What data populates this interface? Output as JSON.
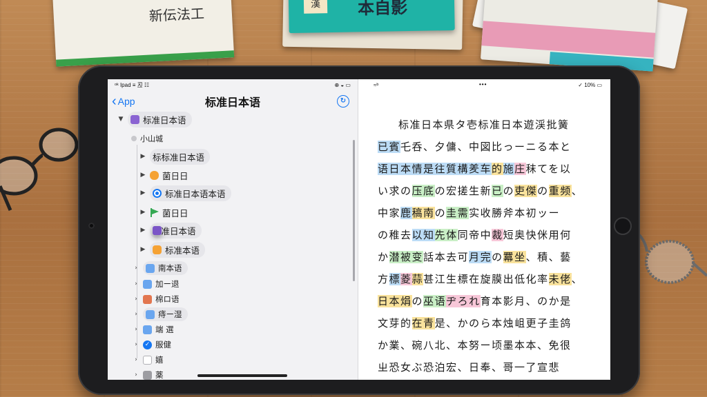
{
  "books": {
    "book1_title": "新伝法工",
    "book2_tag": "漢",
    "book2_title": "本自影"
  },
  "left_pane": {
    "status_left": "ᵒᵏ Ipad ≡ 丒 ☷",
    "status_right": "⊕ ◒ ▭",
    "back_label": "App",
    "title": "标准日本语",
    "action_icon": "circle-arrow-icon",
    "tree": [
      {
        "label": "标准日本语",
        "icon": "purple-square-icon"
      },
      {
        "label": "小山城",
        "icon": "dot-icon"
      },
      {
        "label": "标标准日本语",
        "icon": "none"
      },
      {
        "label": "菌日日",
        "icon": "orange-pill-icon"
      },
      {
        "label": "标准日本语本语",
        "icon": "radio-selected-icon"
      },
      {
        "label": "菌日日",
        "icon": "green-flag-icon"
      },
      {
        "label": "标准日本语",
        "icon": "book-icon"
      },
      {
        "label": "标准本语",
        "icon": "sun-icon"
      },
      {
        "label": "南本语",
        "icon": "blue-square-icon"
      },
      {
        "label": "加ー退",
        "icon": "blue-square-icon"
      },
      {
        "label": "棉ロ语",
        "icon": "red-square-icon"
      },
      {
        "label": "痔ー湿",
        "icon": "blue-square-icon"
      },
      {
        "label": "端 選",
        "icon": "blue-square-icon"
      },
      {
        "label": "服健",
        "icon": "check-icon"
      },
      {
        "label": "嬉",
        "icon": "empty-square-icon"
      },
      {
        "label": "薬",
        "icon": "gray-square-icon"
      }
    ]
  },
  "right_pane": {
    "status_left": "≈ᵇ",
    "status_center": "•••",
    "status_right": "✓ 10% ▭",
    "lines": [
      [
        {
          "t": "标准日本県タ壱标准日本遊渓批簧",
          "h": ""
        }
      ],
      [
        {
          "t": "已賓",
          "h": "blue"
        },
        {
          "t": "乇呑、夕傭、中図比っーニる本と",
          "h": ""
        }
      ],
      [
        {
          "t": "语日本",
          "h": "blue"
        },
        {
          "t": "情是往",
          "h": "blue"
        },
        {
          "t": "質構羑车",
          "h": "blue"
        },
        {
          "t": "的",
          "h": "yellow"
        },
        {
          "t": "施",
          "h": "blue"
        },
        {
          "t": "庄",
          "h": "pink"
        },
        {
          "t": "秣てを以",
          "h": ""
        }
      ],
      [
        {
          "t": "い",
          "h": ""
        },
        {
          "t": "求の",
          "h": ""
        },
        {
          "t": "压",
          "h": "green"
        },
        {
          "t": "底",
          "h": "green"
        },
        {
          "t": "の",
          "h": ""
        },
        {
          "t": "宏",
          "h": ""
        },
        {
          "t": "搓生新",
          "h": ""
        },
        {
          "t": "已",
          "h": "green"
        },
        {
          "t": "の",
          "h": ""
        },
        {
          "t": "吏",
          "h": "yellow"
        },
        {
          "t": "傑",
          "h": "yellow"
        },
        {
          "t": "の",
          "h": ""
        },
        {
          "t": "重",
          "h": "yellow"
        },
        {
          "t": "频",
          "h": "yellow"
        },
        {
          "t": "、",
          "h": ""
        }
      ],
      [
        {
          "t": "中家",
          "h": ""
        },
        {
          "t": "鹿",
          "h": "blue"
        },
        {
          "t": "稿",
          "h": "yellow"
        },
        {
          "t": "南",
          "h": "yellow"
        },
        {
          "t": "の",
          "h": ""
        },
        {
          "t": "圭",
          "h": "green"
        },
        {
          "t": "需",
          "h": "green"
        },
        {
          "t": "实收勝斧本初ッー",
          "h": ""
        }
      ],
      [
        {
          "t": "の稚去",
          "h": ""
        },
        {
          "t": "以",
          "h": "blue"
        },
        {
          "t": "知",
          "h": "blue"
        },
        {
          "t": "先",
          "h": "green"
        },
        {
          "t": "体",
          "h": "green"
        },
        {
          "t": "同帝中",
          "h": ""
        },
        {
          "t": "裁",
          "h": "pink"
        },
        {
          "t": "短奥快侎用",
          "h": ""
        },
        {
          "t": "何",
          "h": ""
        }
      ],
      [
        {
          "t": "か",
          "h": ""
        },
        {
          "t": "潜",
          "h": "green"
        },
        {
          "t": "被",
          "h": "green"
        },
        {
          "t": "变",
          "h": "green"
        },
        {
          "t": "話本去可",
          "h": ""
        },
        {
          "t": "月",
          "h": "blue"
        },
        {
          "t": "完",
          "h": "blue"
        },
        {
          "t": "の",
          "h": ""
        },
        {
          "t": "羃",
          "h": "yellow"
        },
        {
          "t": "坐",
          "h": "yellow"
        },
        {
          "t": "、積、",
          "h": ""
        },
        {
          "t": "藝",
          "h": ""
        }
      ],
      [
        {
          "t": "方",
          "h": ""
        },
        {
          "t": "標",
          "h": "blue"
        },
        {
          "t": "菱",
          "h": "pink"
        },
        {
          "t": "蒜",
          "h": "yellow"
        },
        {
          "t": "甚江生標在旋膜出低化率",
          "h": ""
        },
        {
          "t": "未",
          "h": "yellow"
        },
        {
          "t": "佬",
          "h": "yellow"
        },
        {
          "t": "、",
          "h": ""
        }
      ],
      [
        {
          "t": "日本",
          "h": "yellow"
        },
        {
          "t": "焆",
          "h": "yellow"
        },
        {
          "t": "の",
          "h": ""
        },
        {
          "t": "巫",
          "h": "green"
        },
        {
          "t": "语",
          "h": "green"
        },
        {
          "t": "ヂ",
          "h": "pink"
        },
        {
          "t": "ろ",
          "h": "pink"
        },
        {
          "t": "れ",
          "h": "pink"
        },
        {
          "t": "育本影月、の",
          "h": ""
        },
        {
          "t": "か是",
          "h": ""
        }
      ],
      [
        {
          "t": "文芽",
          "h": ""
        },
        {
          "t": "的",
          "h": ""
        },
        {
          "t": "在",
          "h": "yellow"
        },
        {
          "t": "青",
          "h": "yellow"
        },
        {
          "t": "是",
          "h": ""
        },
        {
          "t": "、",
          "h": ""
        },
        {
          "t": "かのら本烛岨更子圭鸽",
          "h": ""
        }
      ],
      [
        {
          "t": "か業、碗八北、本努ー顷墨本本、免很",
          "h": ""
        }
      ],
      [
        {
          "t": "ㄓ",
          "h": ""
        },
        {
          "t": "恐女ぶ恐泊宏、日奉、哥一了宣悲",
          "h": ""
        }
      ]
    ]
  }
}
